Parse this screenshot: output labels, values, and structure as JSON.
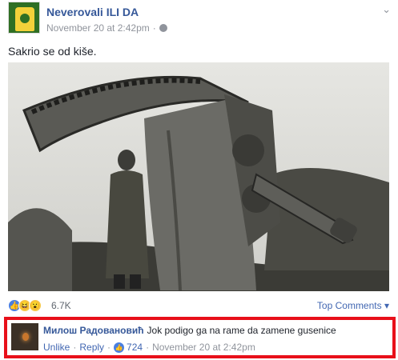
{
  "post": {
    "page_name": "Neverovali ILI DA",
    "timestamp": "November 20 at 2:42pm",
    "separator": "·",
    "text": "Sakrio se od kiše."
  },
  "reactions": {
    "count": "6.7K",
    "top_comments_label": "Top Comments",
    "icons": [
      "like-icon",
      "haha-icon",
      "wow-icon"
    ]
  },
  "comment": {
    "author": "Милош Радовановић",
    "text": "Jok podigo ga na rame da zamene gusenice",
    "unlike_label": "Unlike",
    "reply_label": "Reply",
    "like_count": "724",
    "timestamp": "November 20 at 2:42pm",
    "separator": "·"
  },
  "colors": {
    "link_blue": "#365899",
    "highlight_red": "#e8101a",
    "meta_gray": "#90949c"
  }
}
